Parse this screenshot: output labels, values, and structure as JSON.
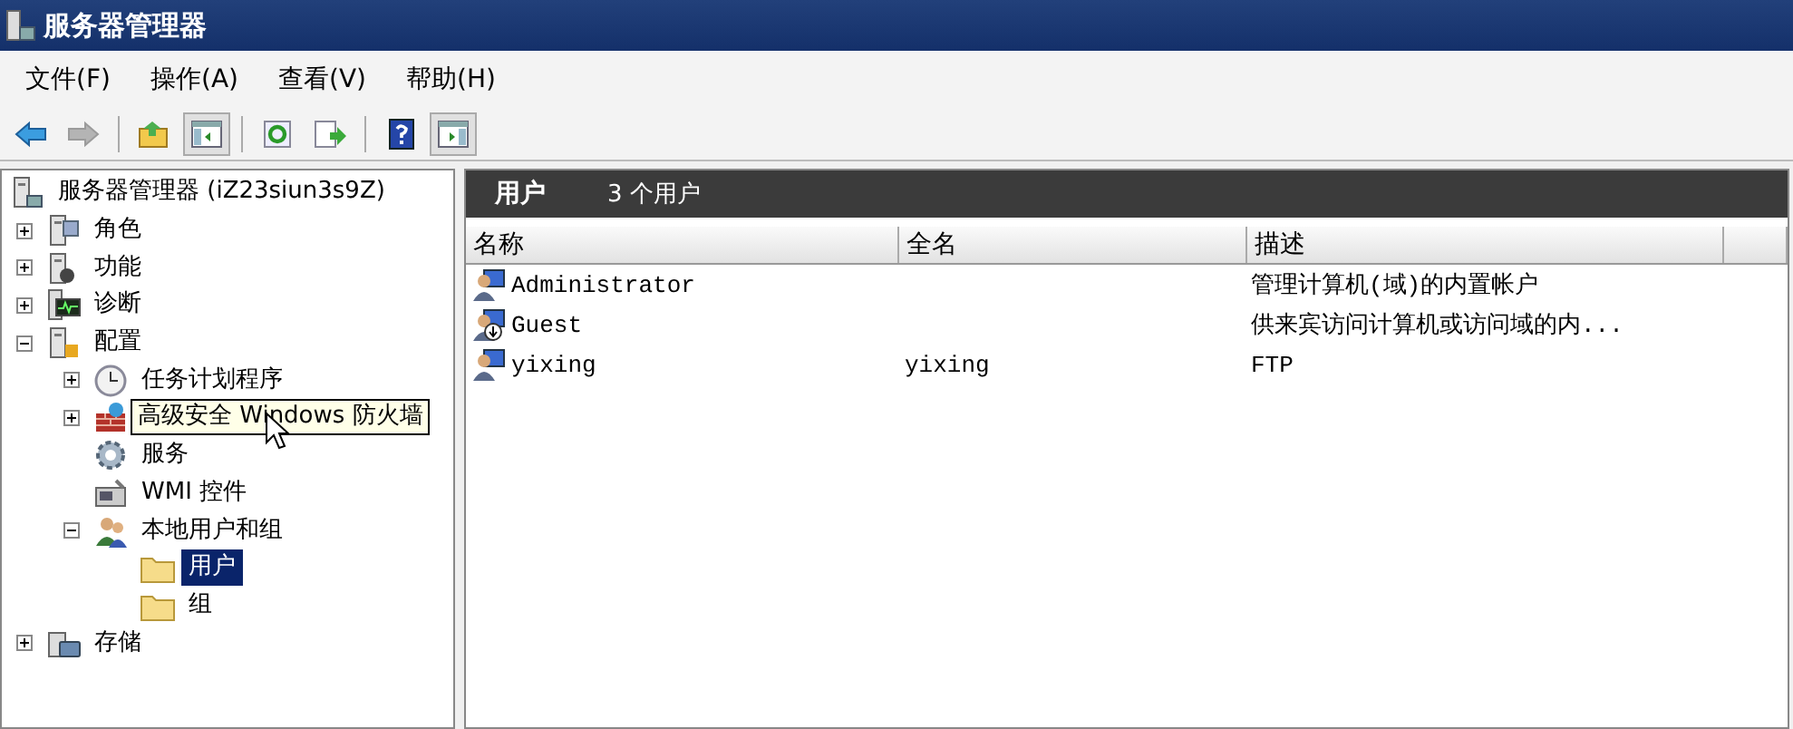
{
  "window": {
    "title": "服务器管理器"
  },
  "menu": [
    {
      "label": "文件(F)"
    },
    {
      "label": "操作(A)"
    },
    {
      "label": "查看(V)"
    },
    {
      "label": "帮助(H)"
    }
  ],
  "toolbar": [
    {
      "kind": "back",
      "disabled": false,
      "pressed": false
    },
    {
      "kind": "forward",
      "disabled": true,
      "pressed": false
    },
    {
      "kind": "up",
      "disabled": false,
      "pressed": false
    },
    {
      "kind": "tree-pane",
      "disabled": false,
      "pressed": true
    },
    {
      "kind": "refresh",
      "disabled": false,
      "pressed": false
    },
    {
      "kind": "export",
      "disabled": false,
      "pressed": false
    },
    {
      "kind": "help",
      "disabled": false,
      "pressed": false
    },
    {
      "kind": "action-pane",
      "disabled": false,
      "pressed": true
    }
  ],
  "tree": {
    "label": "服务器管理器 (iZ23siun3s9Z)",
    "kind": "server",
    "selected": false,
    "hovered": false,
    "children": [
      {
        "label": "角色",
        "kind": "roles",
        "expanded": false,
        "selected": false,
        "hovered": false
      },
      {
        "label": "功能",
        "kind": "features",
        "expanded": false,
        "selected": false,
        "hovered": false
      },
      {
        "label": "诊断",
        "kind": "diagnostics",
        "expanded": false,
        "selected": false,
        "hovered": false
      },
      {
        "label": "配置",
        "kind": "config",
        "expanded": true,
        "selected": false,
        "hovered": false,
        "children": [
          {
            "label": "任务计划程序",
            "kind": "clock",
            "expanded": false,
            "selected": false,
            "hovered": false
          },
          {
            "label": "高级安全 Windows 防火墙",
            "kind": "firewall",
            "expanded": false,
            "selected": false,
            "hovered": true
          },
          {
            "label": "服务",
            "kind": "gear",
            "selected": false,
            "hovered": false
          },
          {
            "label": "WMI 控件",
            "kind": "wmi",
            "selected": false,
            "hovered": false
          },
          {
            "label": "本地用户和组",
            "kind": "users",
            "expanded": true,
            "selected": false,
            "hovered": false,
            "children": [
              {
                "label": "用户",
                "kind": "folder",
                "selected": true,
                "hovered": false
              },
              {
                "label": "组",
                "kind": "folder",
                "selected": false,
                "hovered": false
              }
            ]
          }
        ]
      },
      {
        "label": "存储",
        "kind": "storage",
        "expanded": false,
        "selected": false,
        "hovered": false
      }
    ]
  },
  "panel": {
    "title": "用户",
    "count": "3 个用户"
  },
  "table": {
    "columns": [
      "名称",
      "全名",
      "描述"
    ],
    "rows": [
      {
        "kind": "user",
        "name": "Administrator",
        "full_name": "",
        "description": "管理计算机(域)的内置帐户"
      },
      {
        "kind": "guest",
        "name": "Guest",
        "full_name": "",
        "description": "供来宾访问计算机或访问域的内..."
      },
      {
        "kind": "user",
        "name": "yixing",
        "full_name": "yixing",
        "description": "FTP"
      }
    ]
  }
}
